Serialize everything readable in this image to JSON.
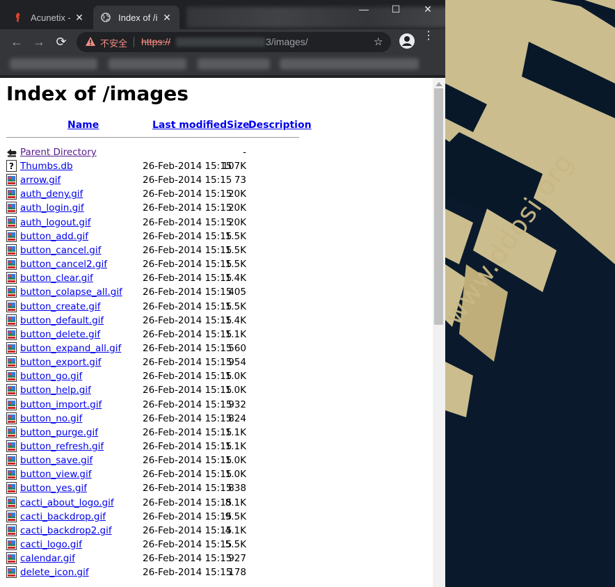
{
  "browser": {
    "tabs": [
      {
        "title": "Acunetix -",
        "active": false
      },
      {
        "title": "Index of /i",
        "active": true
      }
    ],
    "omnibox": {
      "security_label": "不安全",
      "scheme": "https://",
      "path": "3/images/"
    }
  },
  "page": {
    "title": "Index of /images",
    "columns": {
      "name": "Name",
      "modified": "Last modified",
      "size": "Size",
      "description": "Description"
    },
    "parent": {
      "name": "Parent Directory",
      "size": "-"
    },
    "files": [
      {
        "name": "Thumbs.db",
        "modified": "26-Feb-2014 15:15",
        "size": "107K",
        "type": "unknown"
      },
      {
        "name": "arrow.gif",
        "modified": "26-Feb-2014 15:15",
        "size": "73",
        "type": "image"
      },
      {
        "name": "auth_deny.gif",
        "modified": "26-Feb-2014 15:15",
        "size": "20K",
        "type": "image"
      },
      {
        "name": "auth_login.gif",
        "modified": "26-Feb-2014 15:15",
        "size": "20K",
        "type": "image"
      },
      {
        "name": "auth_logout.gif",
        "modified": "26-Feb-2014 15:15",
        "size": "20K",
        "type": "image"
      },
      {
        "name": "button_add.gif",
        "modified": "26-Feb-2014 15:15",
        "size": "1.5K",
        "type": "image"
      },
      {
        "name": "button_cancel.gif",
        "modified": "26-Feb-2014 15:15",
        "size": "1.5K",
        "type": "image"
      },
      {
        "name": "button_cancel2.gif",
        "modified": "26-Feb-2014 15:15",
        "size": "1.5K",
        "type": "image"
      },
      {
        "name": "button_clear.gif",
        "modified": "26-Feb-2014 15:15",
        "size": "1.4K",
        "type": "image"
      },
      {
        "name": "button_colapse_all.gif",
        "modified": "26-Feb-2014 15:15",
        "size": "405",
        "type": "image"
      },
      {
        "name": "button_create.gif",
        "modified": "26-Feb-2014 15:15",
        "size": "1.5K",
        "type": "image"
      },
      {
        "name": "button_default.gif",
        "modified": "26-Feb-2014 15:15",
        "size": "1.4K",
        "type": "image"
      },
      {
        "name": "button_delete.gif",
        "modified": "26-Feb-2014 15:15",
        "size": "1.1K",
        "type": "image"
      },
      {
        "name": "button_expand_all.gif",
        "modified": "26-Feb-2014 15:15",
        "size": "560",
        "type": "image"
      },
      {
        "name": "button_export.gif",
        "modified": "26-Feb-2014 15:15",
        "size": "954",
        "type": "image"
      },
      {
        "name": "button_go.gif",
        "modified": "26-Feb-2014 15:15",
        "size": "1.0K",
        "type": "image"
      },
      {
        "name": "button_help.gif",
        "modified": "26-Feb-2014 15:15",
        "size": "1.0K",
        "type": "image"
      },
      {
        "name": "button_import.gif",
        "modified": "26-Feb-2014 15:15",
        "size": "932",
        "type": "image"
      },
      {
        "name": "button_no.gif",
        "modified": "26-Feb-2014 15:15",
        "size": "824",
        "type": "image"
      },
      {
        "name": "button_purge.gif",
        "modified": "26-Feb-2014 15:15",
        "size": "1.1K",
        "type": "image"
      },
      {
        "name": "button_refresh.gif",
        "modified": "26-Feb-2014 15:15",
        "size": "1.1K",
        "type": "image"
      },
      {
        "name": "button_save.gif",
        "modified": "26-Feb-2014 15:15",
        "size": "1.0K",
        "type": "image"
      },
      {
        "name": "button_view.gif",
        "modified": "26-Feb-2014 15:15",
        "size": "1.0K",
        "type": "image"
      },
      {
        "name": "button_yes.gif",
        "modified": "26-Feb-2014 15:15",
        "size": "838",
        "type": "image"
      },
      {
        "name": "cacti_about_logo.gif",
        "modified": "26-Feb-2014 15:15",
        "size": "8.1K",
        "type": "image"
      },
      {
        "name": "cacti_backdrop.gif",
        "modified": "26-Feb-2014 15:15",
        "size": "9.5K",
        "type": "image"
      },
      {
        "name": "cacti_backdrop2.gif",
        "modified": "26-Feb-2014 15:15",
        "size": "4.1K",
        "type": "image"
      },
      {
        "name": "cacti_logo.gif",
        "modified": "26-Feb-2014 15:15",
        "size": "5.5K",
        "type": "image"
      },
      {
        "name": "calendar.gif",
        "modified": "26-Feb-2014 15:15",
        "size": "927",
        "type": "image"
      },
      {
        "name": "delete_icon.gif",
        "modified": "26-Feb-2014 15:15",
        "size": "178",
        "type": "image"
      }
    ]
  },
  "wallpaper": {
    "watermark": "www.ddosi.org"
  },
  "colors": {
    "link": "#0000ee",
    "visited": "#551a8b",
    "gold": "#c9b784",
    "navy": "#081829"
  }
}
